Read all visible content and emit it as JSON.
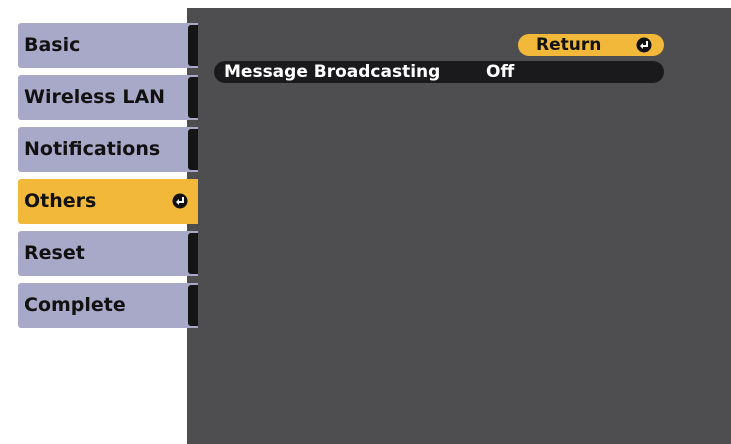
{
  "sidebar": {
    "items": [
      {
        "label": "Basic"
      },
      {
        "label": "Wireless LAN"
      },
      {
        "label": "Notifications"
      },
      {
        "label": "Others",
        "selected": true,
        "icon": "enter-icon"
      },
      {
        "label": "Reset"
      },
      {
        "label": "Complete"
      }
    ]
  },
  "main": {
    "return_label": "Return",
    "return_icon": "enter-icon",
    "settings": [
      {
        "label": "Message Broadcasting",
        "value": "Off"
      }
    ]
  },
  "colors": {
    "selected": "#f2b83a",
    "tab": "#a8a8c8",
    "panel": "#4e4e50",
    "row": "#1a1a1c"
  }
}
